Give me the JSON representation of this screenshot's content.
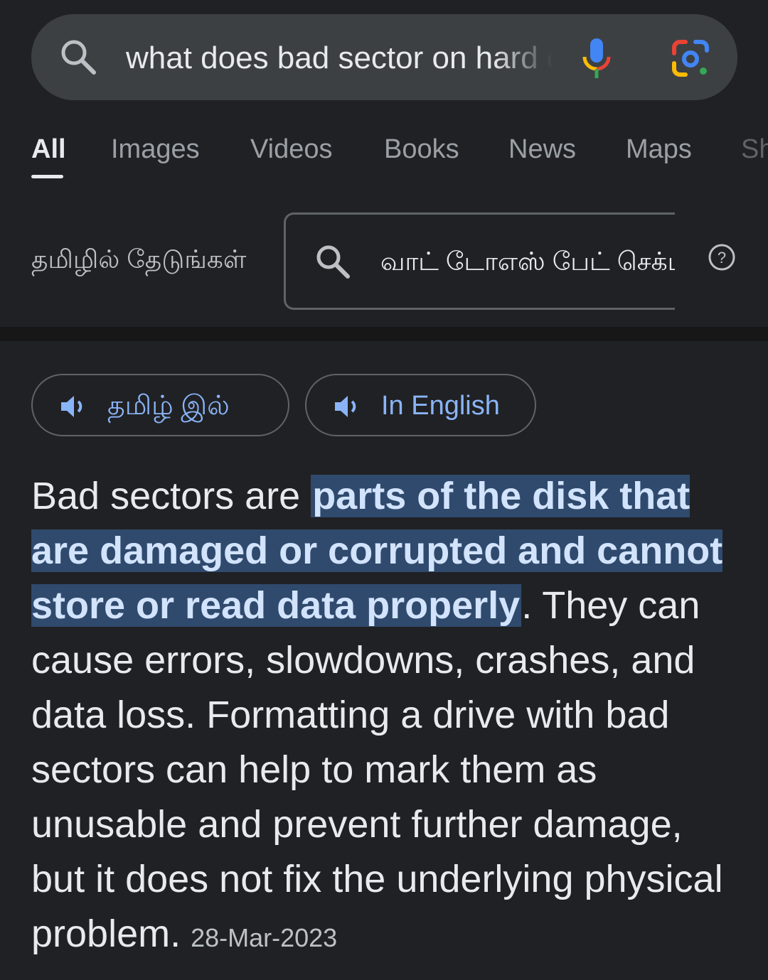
{
  "search": {
    "query": "what does bad sector on hard drive mean"
  },
  "tabs": [
    {
      "label": "All"
    },
    {
      "label": "Images"
    },
    {
      "label": "Videos"
    },
    {
      "label": "Books"
    },
    {
      "label": "News"
    },
    {
      "label": "Maps"
    },
    {
      "label": "Sh"
    }
  ],
  "tamil_search": {
    "label": "தமிழில் தேடுங்கள்",
    "query": "வாட் டோஎஸ் பேட் செக்டர்"
  },
  "listen": {
    "tamil_label": "தமிழ் இல்",
    "english_label": "In English"
  },
  "answer": {
    "prefix": "Bad sectors are ",
    "highlight": "parts of the disk that are damaged or corrupted and cannot store or read data properly",
    "suffix": ". They can cause errors, slowdowns, crashes, and data loss. Formatting a drive with bad sectors can help to mark them as unusable and prevent further damage, but it does not fix the underlying physical problem.",
    "date": "28-Mar-2023"
  },
  "colors": {
    "background": "#202124",
    "search_bar": "#3c4043",
    "link_blue": "#8ab4f8",
    "highlight_bg": "#2f4a6d"
  },
  "icons": [
    "search-icon",
    "mic-icon",
    "google-lens-icon",
    "help-icon",
    "speaker-icon"
  ]
}
